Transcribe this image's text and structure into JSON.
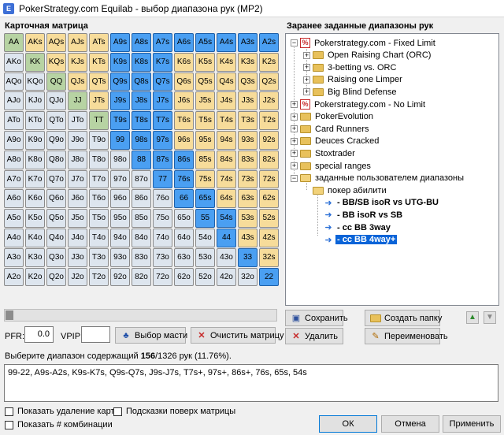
{
  "window": {
    "title": "PokerStrategy.com Equilab - выбор диапазона рук (MP2)"
  },
  "matrix": {
    "label": "Карточная матрица",
    "rows": [
      [
        "AA",
        "AKs",
        "AQs",
        "AJs",
        "ATs",
        "A9s",
        "A8s",
        "A7s",
        "A6s",
        "A5s",
        "A4s",
        "A3s",
        "A2s"
      ],
      [
        "AKo",
        "KK",
        "KQs",
        "KJs",
        "KTs",
        "K9s",
        "K8s",
        "K7s",
        "K6s",
        "K5s",
        "K4s",
        "K3s",
        "K2s"
      ],
      [
        "AQo",
        "KQo",
        "QQ",
        "QJs",
        "QTs",
        "Q9s",
        "Q8s",
        "Q7s",
        "Q6s",
        "Q5s",
        "Q4s",
        "Q3s",
        "Q2s"
      ],
      [
        "AJo",
        "KJo",
        "QJo",
        "JJ",
        "JTs",
        "J9s",
        "J8s",
        "J7s",
        "J6s",
        "J5s",
        "J4s",
        "J3s",
        "J2s"
      ],
      [
        "ATo",
        "KTo",
        "QTo",
        "JTo",
        "TT",
        "T9s",
        "T8s",
        "T7s",
        "T6s",
        "T5s",
        "T4s",
        "T3s",
        "T2s"
      ],
      [
        "A9o",
        "K9o",
        "Q9o",
        "J9o",
        "T9o",
        "99",
        "98s",
        "97s",
        "96s",
        "95s",
        "94s",
        "93s",
        "92s"
      ],
      [
        "A8o",
        "K8o",
        "Q8o",
        "J8o",
        "T8o",
        "98o",
        "88",
        "87s",
        "86s",
        "85s",
        "84s",
        "83s",
        "82s"
      ],
      [
        "A7o",
        "K7o",
        "Q7o",
        "J7o",
        "T7o",
        "97o",
        "87o",
        "77",
        "76s",
        "75s",
        "74s",
        "73s",
        "72s"
      ],
      [
        "A6o",
        "K6o",
        "Q6o",
        "J6o",
        "T6o",
        "96o",
        "86o",
        "76o",
        "66",
        "65s",
        "64s",
        "63s",
        "62s"
      ],
      [
        "A5o",
        "K5o",
        "Q5o",
        "J5o",
        "T5o",
        "95o",
        "85o",
        "75o",
        "65o",
        "55",
        "54s",
        "53s",
        "52s"
      ],
      [
        "A4o",
        "K4o",
        "Q4o",
        "J4o",
        "T4o",
        "94o",
        "84o",
        "74o",
        "64o",
        "54o",
        "44",
        "43s",
        "42s"
      ],
      [
        "A3o",
        "K3o",
        "Q3o",
        "J3o",
        "T3o",
        "93o",
        "83o",
        "73o",
        "63o",
        "53o",
        "43o",
        "33",
        "32s"
      ],
      [
        "A2o",
        "K2o",
        "Q2o",
        "J2o",
        "T2o",
        "92o",
        "82o",
        "72o",
        "62o",
        "52o",
        "42o",
        "32o",
        "22"
      ]
    ],
    "selected": [
      "A9s",
      "A8s",
      "A7s",
      "A6s",
      "A5s",
      "A4s",
      "A3s",
      "A2s",
      "K9s",
      "K8s",
      "K7s",
      "Q9s",
      "Q8s",
      "Q7s",
      "J9s",
      "J8s",
      "J7s",
      "T9s",
      "T8s",
      "T7s",
      "99",
      "98s",
      "97s",
      "88",
      "87s",
      "86s",
      "77",
      "76s",
      "66",
      "65s",
      "55",
      "54s",
      "44",
      "33",
      "22"
    ],
    "colors": {
      "pair": "#b7d3a3",
      "suited": "#f7dc9a",
      "offsuit": "#dde5ee",
      "selected": "#4a9ff2"
    }
  },
  "controls": {
    "slider_value": 0,
    "pfr_label": "PFR:",
    "pfr_value": "0.0",
    "vpip_label": "VPIP:",
    "vpip_value": "",
    "suit_button": "Выбор масти",
    "clear_button": "Очистить матрицу"
  },
  "presets": {
    "label": "Заранее заданные диапазоны рук",
    "nodes": [
      {
        "label": "Pokerstrategy.com - Fixed Limit",
        "icon": "pokerstrategy-icon",
        "expander": "−",
        "level": 0
      },
      {
        "label": "Open Raising Chart (ORC)",
        "icon": "folder-icon",
        "expander": "+",
        "level": 1
      },
      {
        "label": "3-betting vs. ORC",
        "icon": "folder-icon",
        "expander": "+",
        "level": 1
      },
      {
        "label": "Raising one Limper",
        "icon": "folder-icon",
        "expander": "+",
        "level": 1
      },
      {
        "label": "Big Blind Defense",
        "icon": "folder-icon",
        "expander": "+",
        "level": 1
      },
      {
        "label": "Pokerstrategy.com - No Limit",
        "icon": "pokerstrategy-icon",
        "expander": "+",
        "level": 0
      },
      {
        "label": "PokerEvolution",
        "icon": "folder-icon",
        "expander": "+",
        "level": 0
      },
      {
        "label": "Card Runners",
        "icon": "folder-icon",
        "expander": "+",
        "level": 0
      },
      {
        "label": "Deuces Cracked",
        "icon": "folder-icon",
        "expander": "+",
        "level": 0
      },
      {
        "label": "Stoxtrader",
        "icon": "folder-icon",
        "expander": "+",
        "level": 0
      },
      {
        "label": "special ranges",
        "icon": "folder-icon",
        "expander": "+",
        "level": 0
      },
      {
        "label": "заданные пользователем диапазоны",
        "icon": "folder-open-icon",
        "expander": "−",
        "level": 0
      },
      {
        "label": "покер абилити",
        "icon": "folder-open-icon",
        "expander": "",
        "level": 1
      },
      {
        "label": "- BB/SB isoR vs UTG-BU",
        "icon": "arrow-right-icon",
        "expander": "",
        "level": 2,
        "bold": true
      },
      {
        "label": "- BB isoR vs SB",
        "icon": "arrow-right-icon",
        "expander": "",
        "level": 2,
        "bold": true
      },
      {
        "label": "- cc BB 3way",
        "icon": "arrow-right-icon",
        "expander": "",
        "level": 2,
        "bold": true
      },
      {
        "label": "- cc BB 4way+",
        "icon": "arrow-right-icon",
        "expander": "",
        "level": 2,
        "bold": true,
        "selected": true
      }
    ],
    "buttons": {
      "save": "Сохранить",
      "create_folder": "Создать папку",
      "delete": "Удалить",
      "rename": "Переименовать"
    }
  },
  "summary": {
    "prefix": "Выберите диапазон содержащий ",
    "count": "156",
    "suffix": "/1326 рук (11.76%).",
    "range_text": "99-22, A9s-A2s, K9s-K7s, Q9s-Q7s, J9s-J7s, T7s+, 97s+, 86s+, 76s, 65s, 54s"
  },
  "options": {
    "show_card_removal": "Показать удаление карт",
    "show_hints": "Подсказки поверх матрицы",
    "show_combos": "Показать # комбинации"
  },
  "dialog_buttons": {
    "ok": "ОК",
    "cancel": "Отмена",
    "apply": "Применить"
  }
}
